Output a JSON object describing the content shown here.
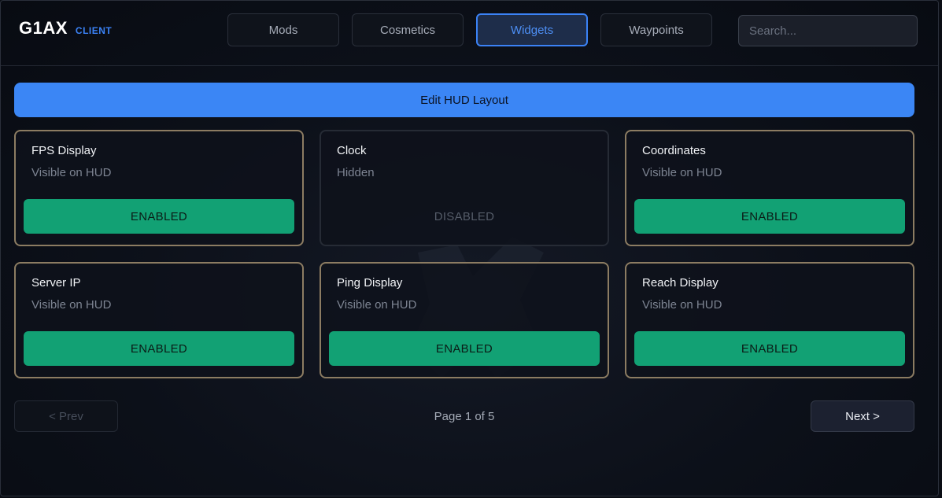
{
  "brand": {
    "name": "G1AX",
    "sub": "CLIENT"
  },
  "tabs": [
    {
      "label": "Mods",
      "active": false
    },
    {
      "label": "Cosmetics",
      "active": false
    },
    {
      "label": "Widgets",
      "active": true
    },
    {
      "label": "Waypoints",
      "active": false
    }
  ],
  "search": {
    "placeholder": "Search...",
    "value": ""
  },
  "edit_hud_label": "Edit HUD Layout",
  "widgets": [
    {
      "title": "FPS Display",
      "status": "Visible on HUD",
      "button": "ENABLED",
      "enabled": true
    },
    {
      "title": "Clock",
      "status": "Hidden",
      "button": "DISABLED",
      "enabled": false
    },
    {
      "title": "Coordinates",
      "status": "Visible on HUD",
      "button": "ENABLED",
      "enabled": true
    },
    {
      "title": "Server IP",
      "status": "Visible on HUD",
      "button": "ENABLED",
      "enabled": true
    },
    {
      "title": "Ping Display",
      "status": "Visible on HUD",
      "button": "ENABLED",
      "enabled": true
    },
    {
      "title": "Reach Display",
      "status": "Visible on HUD",
      "button": "ENABLED",
      "enabled": true
    }
  ],
  "pagination": {
    "prev": "< Prev",
    "info": "Page 1 of 5",
    "next": "Next >"
  },
  "colors": {
    "accent": "#3b82f6",
    "enabled": "#12a174",
    "card_border": "#8c7c62"
  }
}
